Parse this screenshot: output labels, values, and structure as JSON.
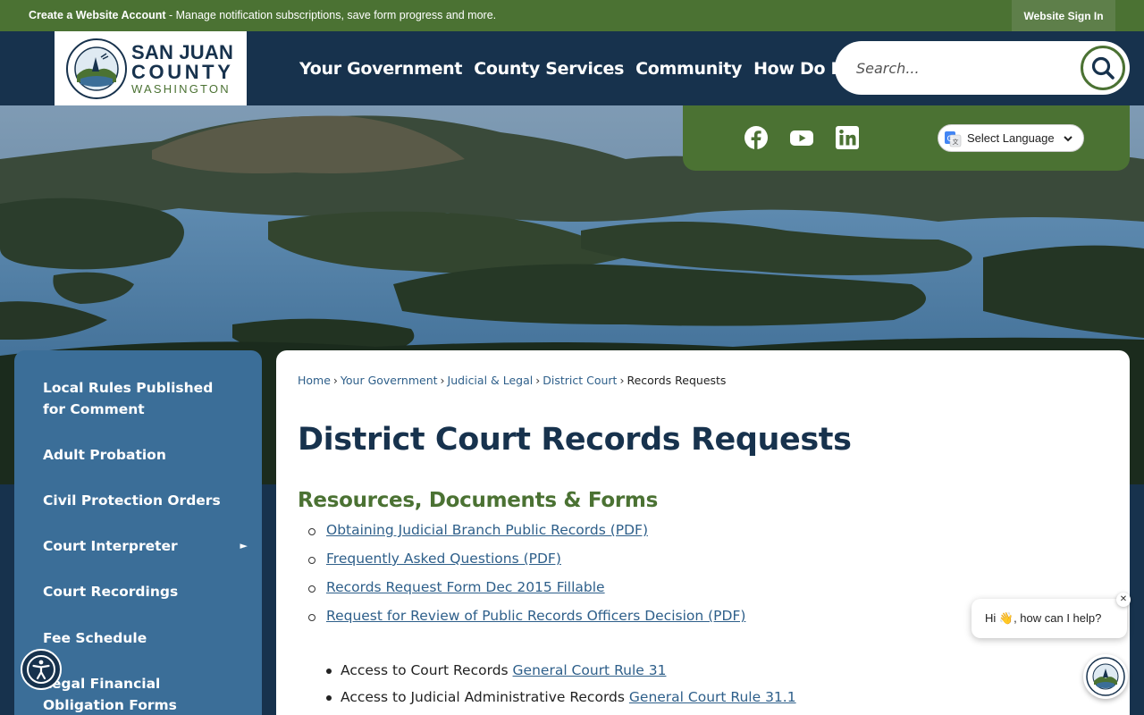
{
  "topbar": {
    "account_link": "Create a Website Account",
    "account_desc": " - Manage notification subscriptions, save form progress and more.",
    "signin": "Website Sign In"
  },
  "logo": {
    "line1": "SAN JUAN",
    "line2": "COUNTY",
    "line3": "WASHINGTON"
  },
  "nav": {
    "items": [
      "Your Government",
      "County Services",
      "Community",
      "How Do I..."
    ]
  },
  "search": {
    "placeholder": "Search..."
  },
  "social": {
    "icons": [
      "facebook-icon",
      "youtube-icon",
      "linkedin-icon"
    ],
    "language_label": "Select Language"
  },
  "sidebar": {
    "items": [
      {
        "label": "Local Rules Published for Comment"
      },
      {
        "label": "Adult Probation"
      },
      {
        "label": "Civil Protection Orders"
      },
      {
        "label": "Court Interpreter",
        "arrow": "►"
      },
      {
        "label": "Court Recordings"
      },
      {
        "label": "Fee Schedule"
      },
      {
        "label": "Legal Financial Obligation Forms"
      }
    ]
  },
  "breadcrumb": {
    "items": [
      "Home",
      "Your Government",
      "Judicial & Legal",
      "District Court"
    ],
    "current": "Records Requests",
    "separator": "›"
  },
  "page": {
    "title": "District Court Records Requests",
    "subheading": "Resources, Documents & Forms",
    "documents": [
      "Obtaining Judicial Branch Public Records (PDF)",
      "Frequently Asked Questions (PDF)",
      "Records Request Form Dec 2015 Fillable",
      "Request for Review of Public Records Officers Decision (PDF)"
    ],
    "rules": [
      {
        "text": "Access to Court Records ",
        "link": "General Court Rule 31"
      },
      {
        "text": "Access to Judicial Administrative Records ",
        "link": "General Court Rule 31.1"
      }
    ]
  },
  "chat": {
    "message": "Hi 👋, how can I help?",
    "close": "✕"
  },
  "colors": {
    "green": "#4b7233",
    "navy": "#17324d",
    "sidebar_blue": "#3b6e98",
    "link": "#2e5f8a"
  }
}
